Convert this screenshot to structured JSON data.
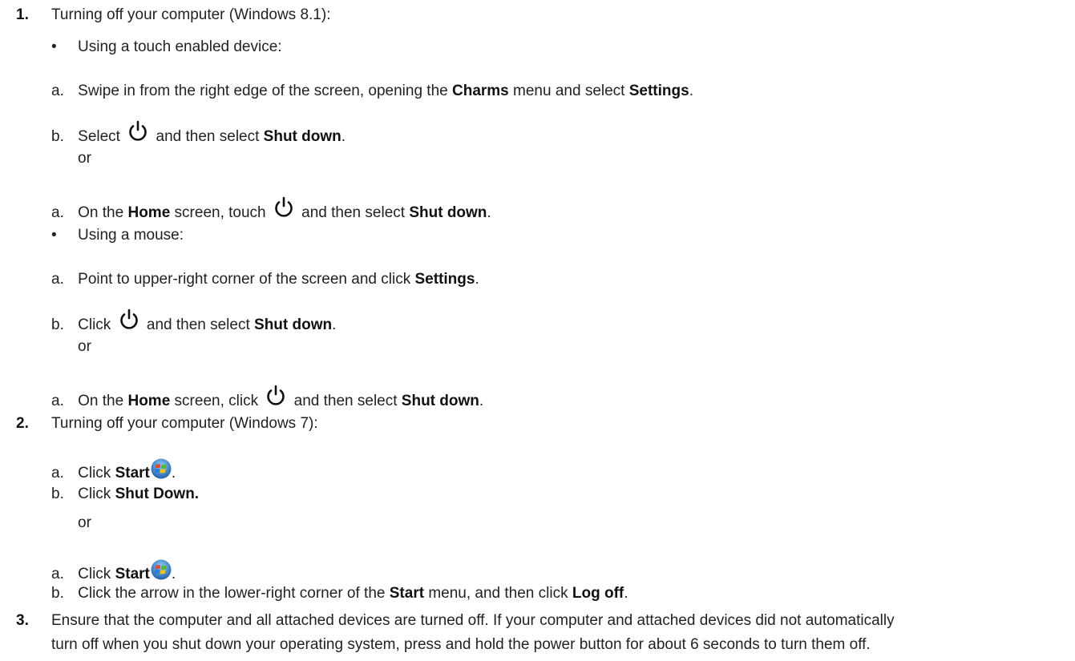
{
  "steps": {
    "s1": {
      "num": "1.",
      "text": "Turning off your computer (Windows 8.1):",
      "touch": {
        "bullet": "•",
        "heading": "Using a touch enabled device:",
        "a1": {
          "letter": "a.",
          "pre": "Swipe in from the right edge of the screen, opening the ",
          "b1": "Charms",
          "mid": " menu and select ",
          "b2": "Settings",
          "post": "."
        },
        "b1": {
          "letter": "b.",
          "pre": "Select ",
          "mid": " and then select ",
          "b": "Shut down",
          "post": "."
        },
        "or": "or",
        "a2": {
          "letter": "a.",
          "pre": "On the ",
          "b1": "Home",
          "mid": " screen, touch ",
          "mid2": " and then select ",
          "b2": "Shut down",
          "post": "."
        }
      },
      "mouse": {
        "bullet": "•",
        "heading": "Using a mouse:",
        "a1": {
          "letter": "a.",
          "pre": "Point to upper-right corner of the screen and click ",
          "b": "Settings",
          "post": "."
        },
        "b1": {
          "letter": "b.",
          "pre": "Click ",
          "mid": " and then select ",
          "b": "Shut down",
          "post": "."
        },
        "or": "or",
        "a2": {
          "letter": "a.",
          "pre": "On the ",
          "b1": "Home",
          "mid": " screen, click ",
          "mid2": " and then select ",
          "b2": "Shut down",
          "post": "."
        }
      }
    },
    "s2": {
      "num": "2.",
      "text": "Turning off your computer (Windows 7):",
      "a1": {
        "letter": "a.",
        "pre": "Click ",
        "b": "Start",
        "post": "."
      },
      "b1": {
        "letter": "b.",
        "pre": "Click ",
        "b": "Shut Down."
      },
      "or": "or",
      "a2": {
        "letter": "a.",
        "pre": "Click ",
        "b": "Start",
        "post": "."
      },
      "b2": {
        "letter": "b.",
        "pre": "Click the arrow in the lower-right corner of the ",
        "b1": "Start",
        "mid": " menu, and then click ",
        "b2": "Log off",
        "post": "."
      }
    },
    "s3": {
      "num": "3.",
      "line1": "Ensure that the computer and all attached devices are turned off. If your computer and attached devices did not automatically",
      "line2": "turn off when you shut down your operating system, press and hold the power button for about 6 seconds to turn them off."
    }
  },
  "icons": {
    "power": "power-icon",
    "windows": "windows-start-icon"
  },
  "colors": {
    "text": "#222222",
    "win_blue": "#2a7fd4",
    "win_red": "#e8452c",
    "win_green": "#5cb531",
    "win_yellow": "#f6c21a"
  }
}
